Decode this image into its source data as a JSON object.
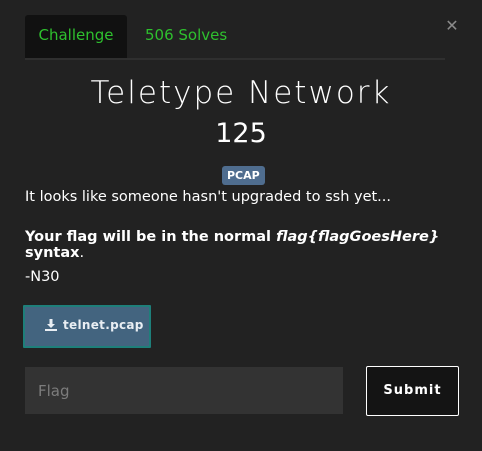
{
  "tabs": {
    "challenge_label": "Challenge",
    "solves_label": "506 Solves"
  },
  "close_icon": "close-icon",
  "challenge": {
    "name": "Teletype Network",
    "value": "125",
    "tag": "PCAP"
  },
  "description": {
    "line1": "It looks like someone hasn't upgraded to ssh yet...",
    "line2_prefix": "Your flag will be in the normal ",
    "line2_italic": "flag{flagGoesHere}",
    "line2_suffix": " syntax",
    "line2_period": ".",
    "line3": "-N30"
  },
  "file": {
    "name": "telnet.pcap",
    "icon": "download-icon"
  },
  "submission": {
    "placeholder": "Flag",
    "submit_label": "Submit"
  },
  "colors": {
    "background": "#222222",
    "tab_accent": "#2ec02e",
    "badge": "#4f6d8f",
    "file_button": "#43647f",
    "file_button_border": "#1e7f7a"
  }
}
